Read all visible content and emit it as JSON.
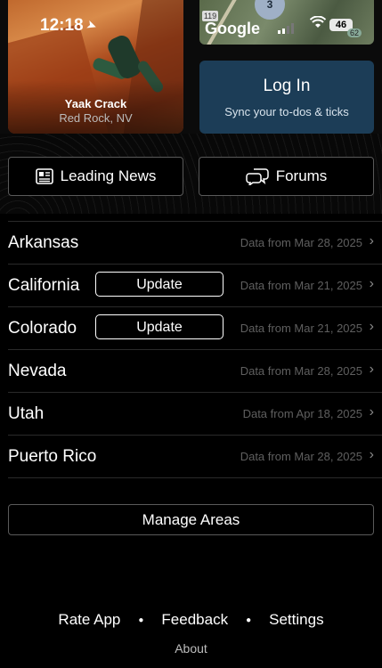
{
  "status_bar": {
    "time": "12:18",
    "battery": "46",
    "badge_119": "119",
    "map_badge": "3",
    "map_small_badge": "62"
  },
  "featured_climb": {
    "name": "Yaak Crack",
    "location": "Red Rock, NV"
  },
  "map": {
    "brand": "Google"
  },
  "login": {
    "title": "Log In",
    "subtitle": "Sync your to-dos & ticks"
  },
  "nav": {
    "news_label": "Leading News",
    "forums_label": "Forums"
  },
  "areas": [
    {
      "name": "Arkansas",
      "update_label": "",
      "date": "Data from Mar 28, 2025"
    },
    {
      "name": "California",
      "update_label": "Update",
      "date": "Data from Mar 21, 2025"
    },
    {
      "name": "Colorado",
      "update_label": "Update",
      "date": "Data from Mar 21, 2025"
    },
    {
      "name": "Nevada",
      "update_label": "",
      "date": "Data from Mar 28, 2025"
    },
    {
      "name": "Utah",
      "update_label": "",
      "date": "Data from Apr 18, 2025"
    },
    {
      "name": "Puerto Rico",
      "update_label": "",
      "date": "Data from Mar 28, 2025"
    }
  ],
  "manage_label": "Manage Areas",
  "footer": {
    "rate": "Rate App",
    "feedback": "Feedback",
    "settings": "Settings",
    "about": "About",
    "separator": "●"
  },
  "icons": {
    "chevron": "›",
    "location_arrow": "➤",
    "wifi": "wifi-icon"
  },
  "colors": {
    "login_bg": "#1c3d57",
    "background": "#000000",
    "date_text": "#5f5f5f"
  }
}
